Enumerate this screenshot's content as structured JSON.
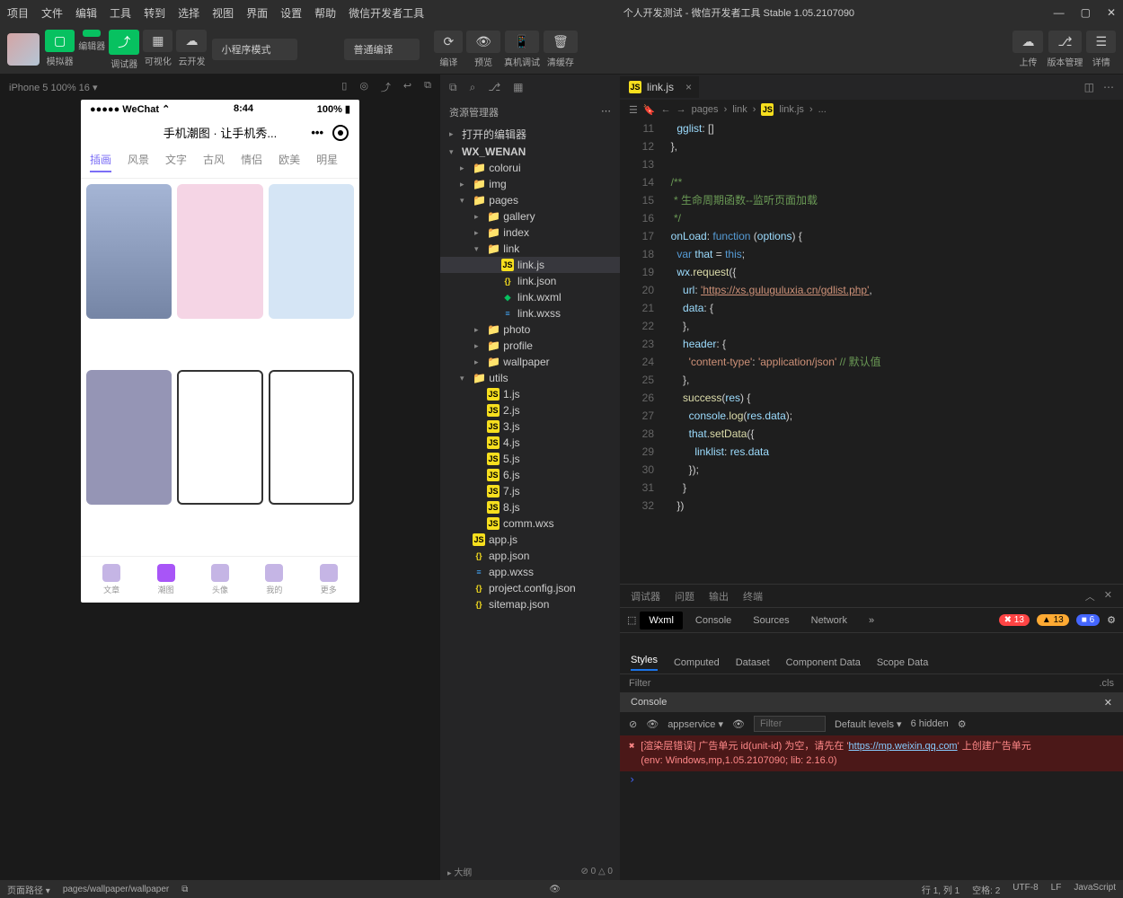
{
  "menu": [
    "项目",
    "文件",
    "编辑",
    "工具",
    "转到",
    "选择",
    "视图",
    "界面",
    "设置",
    "帮助",
    "微信开发者工具"
  ],
  "title": "个人开发测试 - 微信开发者工具 Stable 1.05.2107090",
  "toolbar": {
    "groups": [
      {
        "icon": "▢",
        "label": "模拟器",
        "green": true
      },
      {
        "icon": "</>",
        "label": "编辑器",
        "green": true
      },
      {
        "icon": "⤴",
        "label": "调试器",
        "green": true
      },
      {
        "icon": "▦",
        "label": "可视化",
        "green": false
      },
      {
        "icon": "☁",
        "label": "云开发",
        "green": false
      }
    ],
    "mode": "小程序模式",
    "compile": "普通编译",
    "actions": [
      {
        "icon": "⟳",
        "label": "编译"
      },
      {
        "icon": "👁",
        "label": "预览"
      },
      {
        "icon": "📱",
        "label": "真机调试"
      },
      {
        "icon": "🗑",
        "label": "清缓存"
      }
    ],
    "right": [
      {
        "icon": "☁",
        "label": "上传"
      },
      {
        "icon": "⎇",
        "label": "版本管理"
      },
      {
        "icon": "☰",
        "label": "详情"
      }
    ]
  },
  "simbar": "iPhone 5 100% 16 ▾",
  "phone": {
    "carrier": "●●●●● WeChat ⌃",
    "time": "8:44",
    "battery": "100%",
    "title": "手机潮图 · 让手机秀...",
    "tabs": [
      "插画",
      "风景",
      "文字",
      "古风",
      "情侣",
      "欧美",
      "明星"
    ],
    "nav": [
      "文章",
      "潮图",
      "头像",
      "我的",
      "更多"
    ]
  },
  "explorer": {
    "title": "资源管理器",
    "sections": [
      "打开的编辑器",
      "WX_WENAN"
    ],
    "tree": [
      {
        "name": "colorui",
        "type": "folder",
        "indent": 1
      },
      {
        "name": "img",
        "type": "folder",
        "indent": 1
      },
      {
        "name": "pages",
        "type": "folder",
        "indent": 1,
        "open": true
      },
      {
        "name": "gallery",
        "type": "folder",
        "indent": 2
      },
      {
        "name": "index",
        "type": "folder",
        "indent": 2
      },
      {
        "name": "link",
        "type": "folder",
        "indent": 2,
        "open": true
      },
      {
        "name": "link.js",
        "type": "js",
        "indent": 3,
        "sel": true
      },
      {
        "name": "link.json",
        "type": "json",
        "indent": 3
      },
      {
        "name": "link.wxml",
        "type": "wxml",
        "indent": 3
      },
      {
        "name": "link.wxss",
        "type": "wxss",
        "indent": 3
      },
      {
        "name": "photo",
        "type": "folder",
        "indent": 2
      },
      {
        "name": "profile",
        "type": "folder",
        "indent": 2
      },
      {
        "name": "wallpaper",
        "type": "folder",
        "indent": 2
      },
      {
        "name": "utils",
        "type": "folder",
        "indent": 1,
        "open": true
      },
      {
        "name": "1.js",
        "type": "js",
        "indent": 2
      },
      {
        "name": "2.js",
        "type": "js",
        "indent": 2
      },
      {
        "name": "3.js",
        "type": "js",
        "indent": 2
      },
      {
        "name": "4.js",
        "type": "js",
        "indent": 2
      },
      {
        "name": "5.js",
        "type": "js",
        "indent": 2
      },
      {
        "name": "6.js",
        "type": "js",
        "indent": 2
      },
      {
        "name": "7.js",
        "type": "js",
        "indent": 2
      },
      {
        "name": "8.js",
        "type": "js",
        "indent": 2
      },
      {
        "name": "comm.wxs",
        "type": "js",
        "indent": 2
      },
      {
        "name": "app.js",
        "type": "js",
        "indent": 1
      },
      {
        "name": "app.json",
        "type": "json",
        "indent": 1
      },
      {
        "name": "app.wxss",
        "type": "wxss",
        "indent": 1
      },
      {
        "name": "project.config.json",
        "type": "json",
        "indent": 1
      },
      {
        "name": "sitemap.json",
        "type": "json",
        "indent": 1
      }
    ],
    "outline": "大纲"
  },
  "editor": {
    "tab": "link.js",
    "crumb": [
      "pages",
      "link",
      "link.js",
      "..."
    ],
    "code": [
      {
        "t": "    gglist: []",
        "cls": ""
      },
      {
        "t": "  },",
        "cls": ""
      },
      {
        "t": "",
        "cls": ""
      },
      {
        "t": "  /**",
        "cls": "com"
      },
      {
        "t": "   * 生命周期函数--监听页面加载",
        "cls": "com"
      },
      {
        "t": "   */",
        "cls": "com"
      },
      {
        "t": "  onLoad: function (options) {",
        "cls": "fn"
      },
      {
        "t": "    var that = this;",
        "cls": "var"
      },
      {
        "t": "    wx.request({",
        "cls": "call"
      },
      {
        "t": "      url: 'https://xs.guluguluxia.cn/gdlist.php',",
        "cls": "url"
      },
      {
        "t": "      data: {",
        "cls": ""
      },
      {
        "t": "      },",
        "cls": ""
      },
      {
        "t": "      header: {",
        "cls": ""
      },
      {
        "t": "        'content-type': 'application/json' // 默认值",
        "cls": "hdr"
      },
      {
        "t": "      },",
        "cls": ""
      },
      {
        "t": "      success(res) {",
        "cls": "fn2"
      },
      {
        "t": "        console.log(res.data);",
        "cls": "call"
      },
      {
        "t": "        that.setData({",
        "cls": "call"
      },
      {
        "t": "          linklist: res.data",
        "cls": ""
      },
      {
        "t": "        });",
        "cls": ""
      },
      {
        "t": "      }",
        "cls": ""
      },
      {
        "t": "    })",
        "cls": ""
      }
    ]
  },
  "debugger": {
    "tabs": [
      "调试器",
      "问题",
      "输出",
      "终端"
    ],
    "devtabs": [
      "Wxml",
      "Console",
      "Sources",
      "Network"
    ],
    "counts": {
      "err": "13",
      "warn": "13",
      "info": "6"
    },
    "styleTabs": [
      "Styles",
      "Computed",
      "Dataset",
      "Component Data",
      "Scope Data"
    ],
    "filter": "Filter",
    "cls": ".cls",
    "console": {
      "title": "Console",
      "ctx": "appservice",
      "filterPh": "Filter",
      "levels": "Default levels ▾",
      "hidden": "6 hidden",
      "err1": "[渲染层错误] 广告单元 id(unit-id) 为空，请先在 '",
      "errUrl": "https://mp.weixin.qq.com",
      "err2": "' 上创建广告单元",
      "env": "(env: Windows,mp,1.05.2107090; lib: 2.16.0)"
    }
  },
  "status": {
    "left": [
      "页面路径 ▾",
      "pages/wallpaper/wallpaper"
    ],
    "mid": "⊘ 0 △ 0",
    "right": [
      "行 1, 列 1",
      "空格: 2",
      "UTF-8",
      "LF",
      "JavaScript"
    ]
  }
}
